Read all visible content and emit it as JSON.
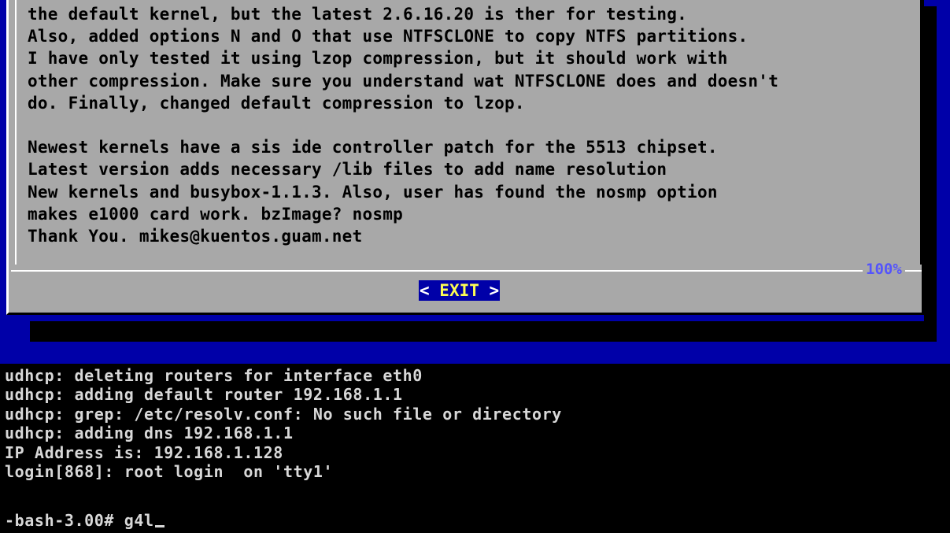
{
  "dialog": {
    "text_lines": [
      "the default kernel, but the latest 2.6.16.20 is ther for testing.",
      "Also, added options N and O that use NTFSCLONE to copy NTFS partitions.",
      "I have only tested it using lzop compression, but it should work with",
      "other compression. Make sure you understand wat NTFSCLONE does and doesn't",
      "do. Finally, changed default compression to lzop.",
      "",
      "Newest kernels have a sis ide controller patch for the 5513 chipset.",
      "Latest version adds necessary /lib files to add name resolution",
      "New kernels and busybox-1.1.3. Also, user has found the nosmp option",
      "makes e1000 card work. bzImage? nosmp",
      "Thank You. mikes@kuentos.guam.net"
    ],
    "scroll_percent": "100%",
    "exit_button": {
      "left_bracket": "< ",
      "label": "EXIT",
      "right_bracket": " >"
    }
  },
  "console": {
    "lines": [
      "udhcp: deleting routers for interface eth0",
      "udhcp: adding default router 192.168.1.1",
      "udhcp: grep: /etc/resolv.conf: No such file or directory",
      "udhcp: adding dns 192.168.1.1",
      "IP Address is: 192.168.1.128",
      "login[868]: root login  on 'tty1'"
    ],
    "prompt": "-bash-3.00# ",
    "command": "g4l"
  },
  "colors": {
    "backdrop": "#0000a8",
    "dialog_bg": "#a8a8a8",
    "percent": "#5454fc",
    "button_bg": "#0000a8",
    "button_hot": "#fcfc54",
    "console_text": "#d8d8d8"
  }
}
